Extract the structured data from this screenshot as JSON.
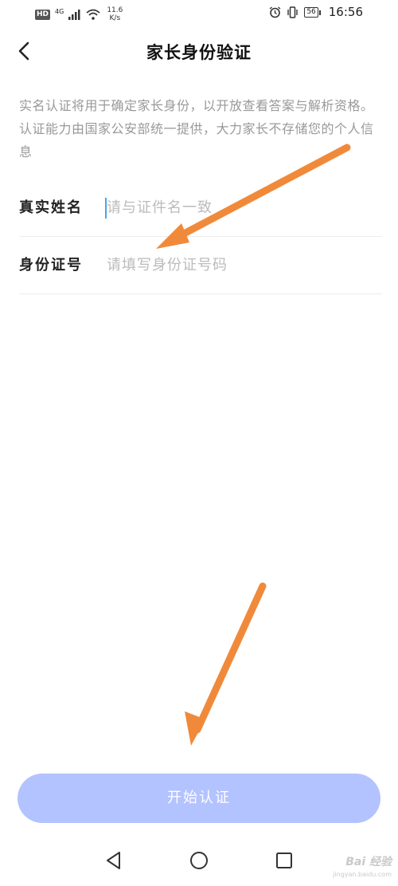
{
  "status_bar": {
    "hd": "HD",
    "net_speed_value": "11.6",
    "net_speed_unit": "K/s",
    "signal": "4G",
    "battery": "56",
    "time": "16:56"
  },
  "header": {
    "title": "家长身份验证"
  },
  "intro_text": "实名认证将用于确定家长身份，以开放查看答案与解析资格。认证能力由国家公安部统一提供，大力家长不存储您的个人信息",
  "form": {
    "name_label": "真实姓名",
    "name_placeholder": "请与证件名一致",
    "name_value": "",
    "id_label": "身份证号",
    "id_placeholder": "请填写身份证号码",
    "id_value": ""
  },
  "submit_label": "开始认证",
  "watermark": {
    "text": "Bai 经验",
    "url": "jingyan.baidu.com"
  },
  "colors": {
    "button_bg": "#b3c3ff",
    "annotation_arrow": "#f08a3a",
    "caret": "#4aa3e8"
  }
}
